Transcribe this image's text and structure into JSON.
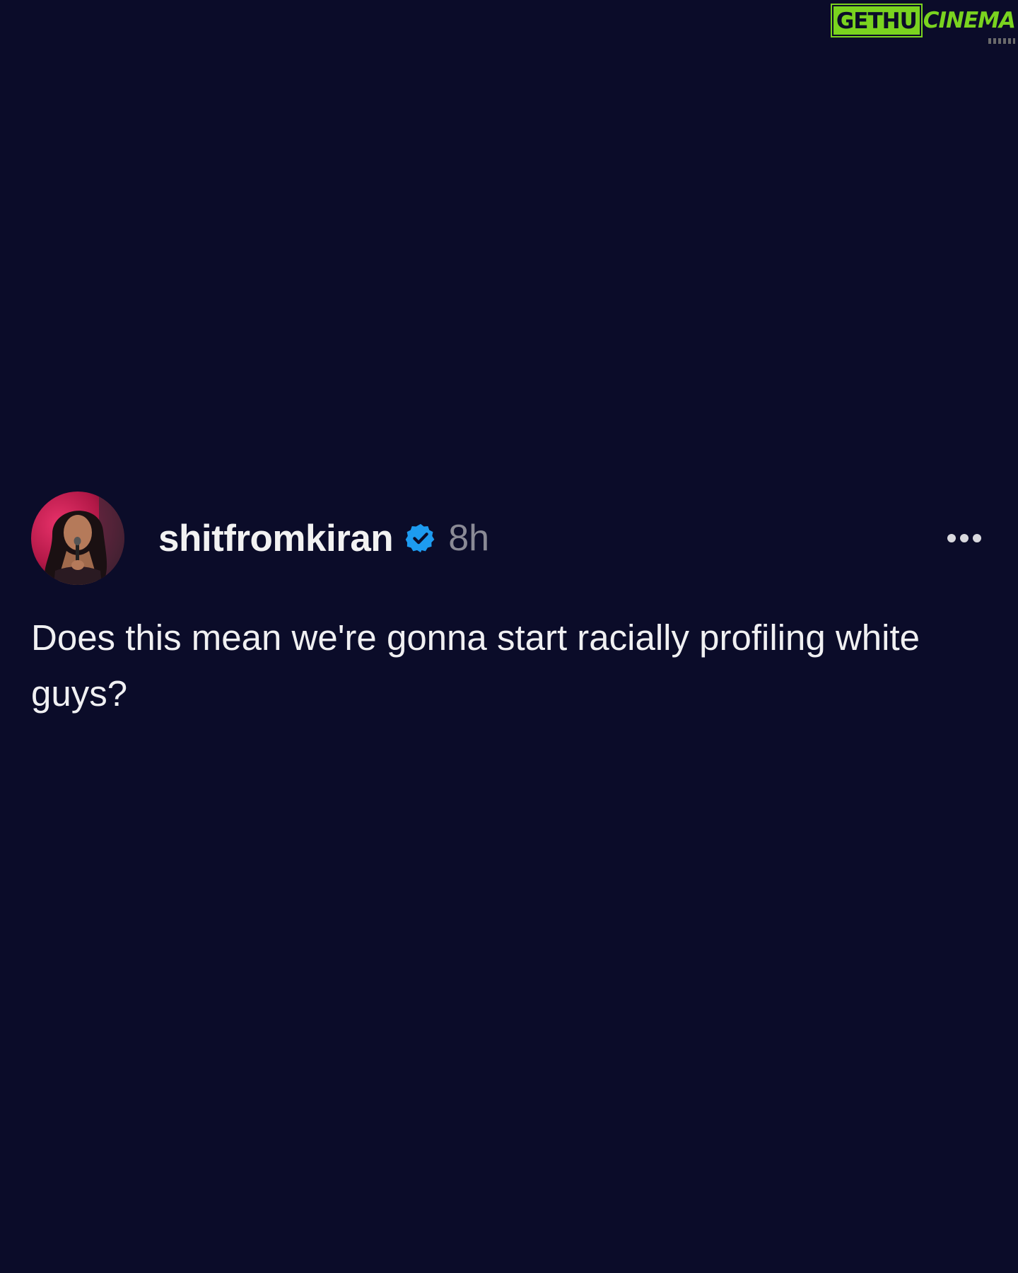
{
  "watermark": {
    "left": "GETHU",
    "right": "CINEMA",
    "color": "#7ad31f"
  },
  "post": {
    "avatar_icon": "profile-photo-icon",
    "username": "shitfromkiran",
    "verified_icon": "verified-badge-icon",
    "verified_color": "#1d9bf0",
    "timestamp": "8h",
    "more_icon": "more-options-icon",
    "text": "Does this mean we're gonna start racially profiling white guys?"
  },
  "colors": {
    "background": "#0b0c29",
    "text": "#f0f0f2",
    "muted": "#8a8a95"
  }
}
